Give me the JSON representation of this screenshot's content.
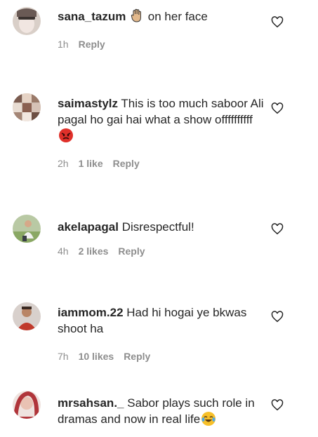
{
  "comments": [
    {
      "username": "sana_tazum",
      "text": " on her face",
      "emoji": "raised-hand-emoji",
      "time": "1h",
      "likes": "",
      "reply": "Reply"
    },
    {
      "username": "saimastylz",
      "text": "This is too much saboor Ali pagal ho gai hai what a show offffffffff",
      "emoji": "angry-face-emoji",
      "time": "2h",
      "likes": "1 like",
      "reply": "Reply"
    },
    {
      "username": "akelapagal",
      "text": "Disrespectful!",
      "time": "4h",
      "likes": "2 likes",
      "reply": "Reply"
    },
    {
      "username": "iammom.22",
      "text": "Had hi hogai ye bkwas shoot ha",
      "time": "7h",
      "likes": "10 likes",
      "reply": "Reply"
    },
    {
      "username": "mrsahsan._",
      "text": "Sabor plays such role in dramas and now in real life",
      "emoji": "laughing-tears-emoji",
      "time": "",
      "likes": "",
      "reply": ""
    }
  ],
  "colors": {
    "text": "#262626",
    "meta": "#8e8e8e",
    "angry": "#e0302a",
    "laughing": "#f7c02a"
  }
}
